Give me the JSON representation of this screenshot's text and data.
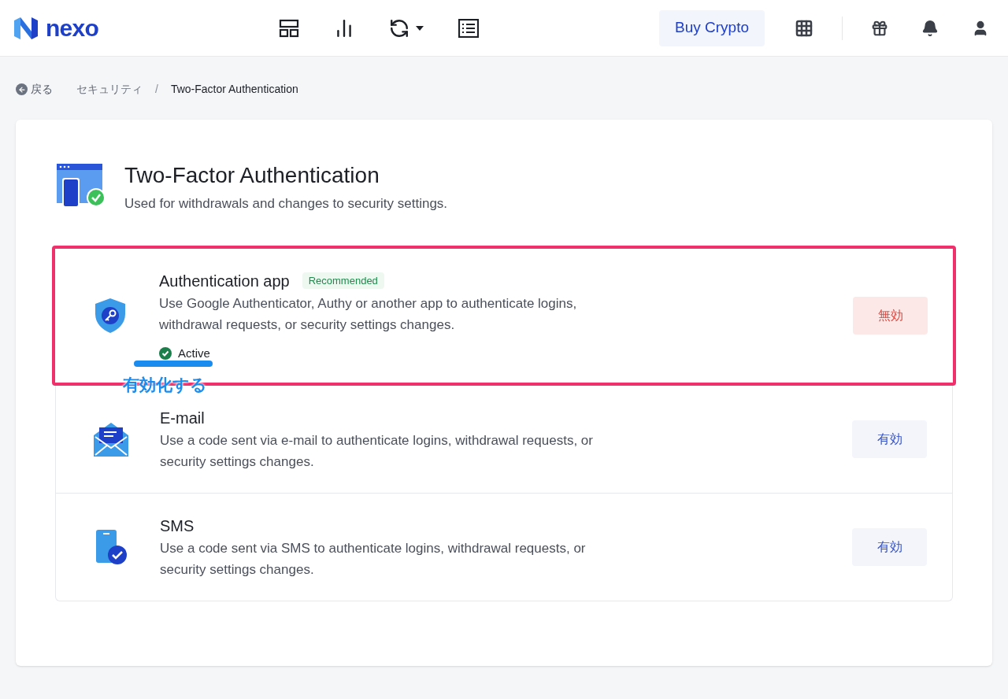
{
  "header": {
    "logo": "nexo",
    "buy_button": "Buy Crypto"
  },
  "breadcrumb": {
    "back": "戻る",
    "items": [
      "セキュリティ",
      "Two-Factor Authentication"
    ],
    "separator": "/"
  },
  "page": {
    "title": "Two-Factor Authentication",
    "subtitle": "Used for withdrawals and changes to security settings."
  },
  "methods": [
    {
      "kind": "app",
      "title": "Authentication app",
      "badge": "Recommended",
      "description": "Use Google Authenticator, Authy or another app to authenticate logins, withdrawal requests, or security settings changes.",
      "active": true,
      "status": "Active",
      "button": "無効",
      "highlighted": true,
      "annotation": "有効化する"
    },
    {
      "kind": "email",
      "title": "E-mail",
      "description": "Use a code sent via e-mail to authenticate logins, withdrawal requests, or security settings changes.",
      "active": false,
      "button": "有効",
      "highlighted": false
    },
    {
      "kind": "sms",
      "title": "SMS",
      "description": "Use a code sent via SMS to authenticate logins, withdrawal requests, or security settings changes.",
      "active": false,
      "button": "有効",
      "highlighted": false
    }
  ]
}
